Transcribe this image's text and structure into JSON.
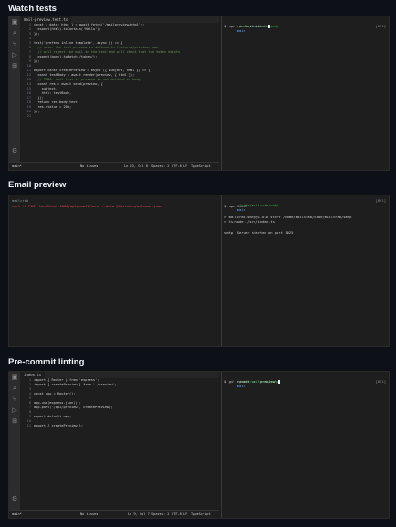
{
  "sections": [
    {
      "title": "Watch tests",
      "editor": {
        "tab": "mail-preview.test.ts",
        "lines": [
          [
            "p",
            "const { data: html } = await fetch('/mailpreview/html');"
          ],
          [
            "p",
            "  expect(html).toContain('Hello');"
          ],
          [
            "p",
            "});"
          ],
          [
            "p",
            ""
          ],
          [
            "p",
            "test('prefers inline template', async () => {"
          ],
          [
            "c",
            "  // note: the text preview is defined in fixtures/preview.json"
          ],
          [
            "c",
            "  // will reject the mail in the test and will check that the token exists"
          ],
          [
            "p",
            "  expect(body).toMatch(/token/);"
          ],
          [
            "p",
            "});"
          ],
          [
            "p",
            ""
          ],
          [
            "p",
            "export const createPreview = async ({ subject, html }) => {"
          ],
          [
            "p",
            "  const testBody = await render(preview, { html });"
          ],
          [
            "c",
            "  // TODO: fail test if preview is not defined in body"
          ],
          [
            "p",
            "  const res = await send(preview, {"
          ],
          [
            "p",
            "    subject,"
          ],
          [
            "p",
            "    html: testBody,"
          ],
          [
            "p",
            "  });"
          ],
          [
            "p",
            "  return res.body.text;"
          ],
          [
            "p",
            "  res.status = 200;"
          ],
          [
            "p",
            "});"
          ],
          [
            "p",
            ""
          ]
        ],
        "status": [
          "main*",
          "No issues",
          "Ln 23, Col 8",
          "Spaces: 2",
          "UTF-8",
          "LF",
          "TypeScript"
        ]
      },
      "terminal": {
        "prompt_path": "~/code/mailcrab/smtp",
        "prompt_branch": "main",
        "lines": [
          [
            "cmd",
            "$ npm run test:watch"
          ]
        ],
        "right": "[0/1]"
      }
    },
    {
      "title": "Email preview",
      "left_terminal": {
        "lines": [
          [
            "dim",
            "mailcrab"
          ],
          [
            "red",
            "curl -X POST localhost:1080/api/email/send --data @fixtures/welcome.json"
          ]
        ]
      },
      "terminal": {
        "prompt_path": "~/code/mailcrab/smtp",
        "prompt_branch": "main",
        "lines": [
          [
            "cmd",
            "$ npm start"
          ],
          [
            "p",
            ""
          ],
          [
            "p",
            "> mailcrab-smtp@1.0.0 start /home/mailcrab/code/mailcrab/smtp"
          ],
          [
            "p",
            "> ts-node ./src/index.ts"
          ],
          [
            "p",
            ""
          ],
          [
            "p",
            "smtp: Server started on port 1025"
          ]
        ],
        "right": "[0/1]"
      }
    },
    {
      "title": "Pre-commit linting",
      "editor": {
        "tab": "index.ts",
        "lines": [
          [
            "p",
            "import { Router } from 'express';"
          ],
          [
            "p",
            "import { createPreview } from './preview';"
          ],
          [
            "p",
            ""
          ],
          [
            "p",
            "const app = Router();"
          ],
          [
            "p",
            ""
          ],
          [
            "p",
            "app.use(express.json());"
          ],
          [
            "p",
            "app.post('/api/preview', createPreview);"
          ],
          [
            "p",
            ""
          ],
          [
            "p",
            "export default app;"
          ],
          [
            "p",
            ""
          ],
          [
            "p",
            "export { createPreview };"
          ]
        ],
        "status": [
          "main*",
          "No issues",
          "Ln 9, Col 7",
          "Spaces: 2",
          "UTF-8",
          "LF",
          "TypeScript"
        ]
      },
      "terminal": {
        "prompt_path": "~/code/mailcrab/smtp",
        "prompt_branch": "main",
        "lines": [
          [
            "cmd",
            "$ git commit -m 'preview'"
          ]
        ],
        "right": "[0/1]"
      }
    }
  ],
  "icons": [
    "files-icon",
    "search-icon",
    "source-control-icon",
    "debug-icon",
    "extensions-icon",
    "settings-icon"
  ]
}
